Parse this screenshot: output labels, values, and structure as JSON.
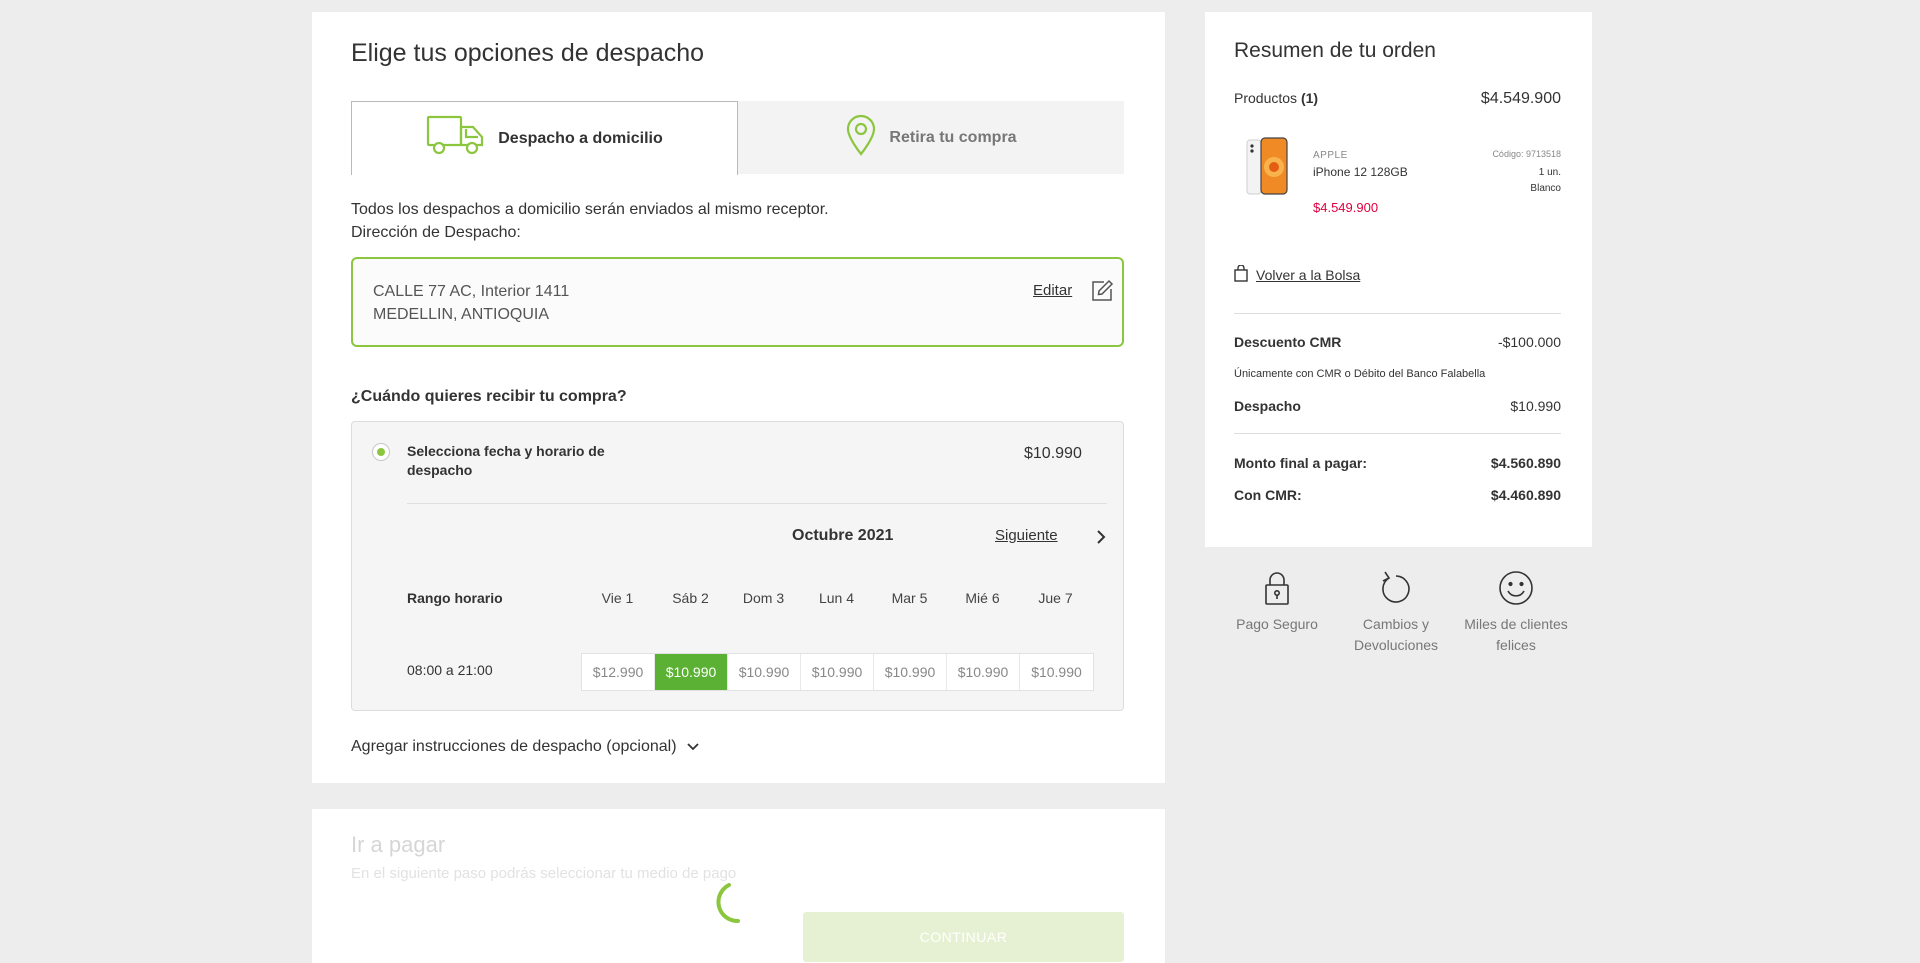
{
  "shipping": {
    "title": "Elige tus opciones de despacho",
    "tabs": [
      {
        "label": "Despacho a domicilio",
        "active": true
      },
      {
        "label": "Retira tu compra",
        "active": false
      }
    ],
    "info_line1": "Todos los despachos a domicilio serán enviados al mismo receptor.",
    "info_line2": "Dirección de Despacho:",
    "address": {
      "line1": "CALLE 77 AC, Interior 1411",
      "line2": "MEDELLIN, ANTIOQUIA",
      "edit_label": "Editar"
    },
    "when_title": "¿Cuándo quieres recibir tu compra?",
    "option": {
      "label": "Selecciona fecha y horario de despacho",
      "price": "$10.990",
      "selected": true
    },
    "calendar": {
      "month": "Octubre 2021",
      "next_label": "Siguiente",
      "range_label": "Rango horario",
      "days": [
        "Vie 1",
        "Sáb 2",
        "Dom 3",
        "Lun 4",
        "Mar 5",
        "Mié 6",
        "Jue 7"
      ],
      "hour": "08:00 a 21:00",
      "slot_prices": [
        "$12.990",
        "$10.990",
        "$10.990",
        "$10.990",
        "$10.990",
        "$10.990",
        "$10.990"
      ],
      "selected_index": 1
    },
    "instructions_label": "Agregar instrucciones de despacho (opcional)"
  },
  "payment": {
    "title": "Ir a pagar",
    "subtitle": "En el siguiente paso podrás seleccionar tu medio de pago",
    "continue_label": "CONTINUAR"
  },
  "summary": {
    "title": "Resumen de tu orden",
    "products_label": "Productos",
    "products_count": "(1)",
    "products_total": "$4.549.900",
    "product": {
      "brand": "APPLE",
      "name": "iPhone 12 128GB",
      "price": "$4.549.900",
      "code": "Código: 9713518",
      "qty": "1 un.",
      "color": "Blanco"
    },
    "back_label": "Volver a la Bolsa",
    "discount_label": "Descuento CMR",
    "discount_value": "-$100.000",
    "discount_note": "Únicamente con CMR o Débito del Banco Falabella",
    "shipping_label": "Despacho",
    "shipping_value": "$10.990",
    "final_label": "Monto final a pagar:",
    "final_value": "$4.560.890",
    "cmr_label": "Con CMR:",
    "cmr_value": "$4.460.890"
  },
  "features": [
    {
      "icon": "lock-icon",
      "label": "Pago Seguro"
    },
    {
      "icon": "return-arrow-icon",
      "label": "Cambios y Devoluciones"
    },
    {
      "icon": "smiley-icon",
      "label": "Miles de clientes felices"
    }
  ],
  "colors": {
    "accent": "#8cc63f",
    "selected_slot": "#5ab133",
    "price_red": "#e0003c"
  }
}
